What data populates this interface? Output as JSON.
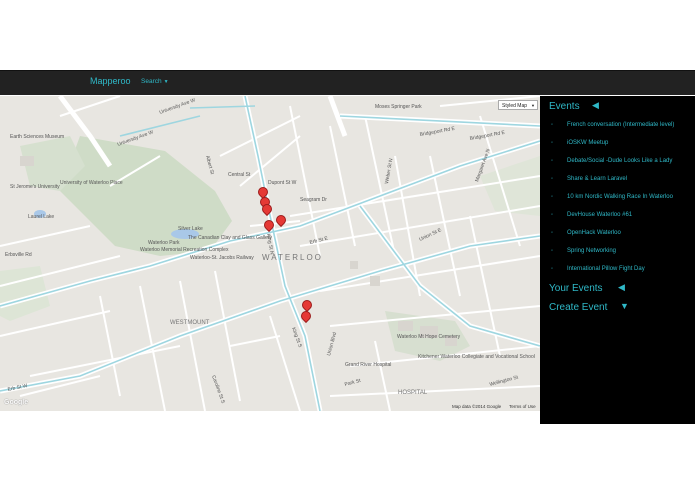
{
  "navbar": {
    "brand": "Mapperoo",
    "search": "Search"
  },
  "map": {
    "styled_map": "Styled Map",
    "google": "Google",
    "attribution": [
      "Map data ©2014 Google",
      "Terms of Use"
    ],
    "labels": [
      "University Ave W",
      "University Ave W",
      "Earth Sciences Museum",
      "St Jerome's University",
      "University of Waterloo Place",
      "Laurel Lake",
      "Silver Lake",
      "Waterloo Park",
      "Waterloo Memorial Recreation Complex",
      "The Canadian Clay and Glass Gallery",
      "Waterloo-St. Jacobs Railway",
      "WATERLOO",
      "WESTMOUNT",
      "Erb St W",
      "Erb St E",
      "Bridgeport Rd E",
      "Bridgeport Rd E",
      "King St N",
      "King St S",
      "Union Blvd",
      "Weber St N",
      "Union St E",
      "Moses Springer Park",
      "Waterloo Mt Hope Cemetery",
      "Kitchener Waterloo Collegiate and Vocational School",
      "Grand River Hospital",
      "Park St",
      "Albert St",
      "Caroline St S",
      "Central St",
      "Dupont St W",
      "Seagram Dr",
      "Erbsville Rd",
      "Margaret Ave N",
      "Wellington St",
      "HOSPITAL"
    ]
  },
  "sidebar": {
    "events_title": "Events",
    "events": [
      "French conversation (Intermediate level)",
      "iOSKW Meetup",
      "Debate/Social -Dude Looks Like a Lady",
      "Share & Learn Laravel",
      "10 km Nordic Walking Race In Waterloo",
      "DevHouse Waterloo #61",
      "OpenHack Waterloo",
      "Spring Networking",
      "International Pillow Fight Day"
    ],
    "your_events_title": "Your Events",
    "create_event_title": "Create Event"
  },
  "colors": {
    "accent": "#2fb8c7",
    "navbar": "#222222",
    "sidebar": "#000000",
    "marker": "#e53935"
  }
}
